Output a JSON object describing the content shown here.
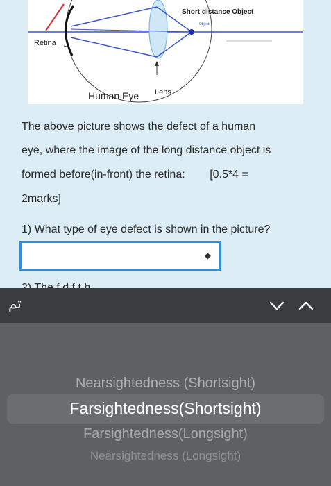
{
  "figure": {
    "label_short_distance": "Short distance Object",
    "label_object": "Object",
    "label_retina": "Retina",
    "label_human_eye": "Human Eye",
    "label_lens": "Lens"
  },
  "question": {
    "intro_lines": [
      "The above picture shows the defect of a human",
      "eye, where the image of the long distance object is",
      "formed before(in-front) the retina:        [0.5*4 =",
      "2marks]"
    ],
    "q1": "1) What type of eye defect is shown in the picture?",
    "select_value": "",
    "next_question_partial": "2) The        f                 d   f   t   h"
  },
  "toolbar": {
    "done_label": "تم",
    "down_icon": "chevron-down-icon",
    "up_icon": "chevron-up-icon"
  },
  "picker": {
    "options": [
      "Nearsightedness (Shortsight)",
      "Farsightedness(Shortsight)",
      "Farsightedness(Longsight)",
      "Nearsightedness (Longsight)"
    ],
    "selected_index": 1
  },
  "colors": {
    "page_bg": "#dcedf6",
    "select_border": "#2f8fe0",
    "toolbar_bg": "#3a3d40",
    "picker_bg": "#5e6164"
  }
}
